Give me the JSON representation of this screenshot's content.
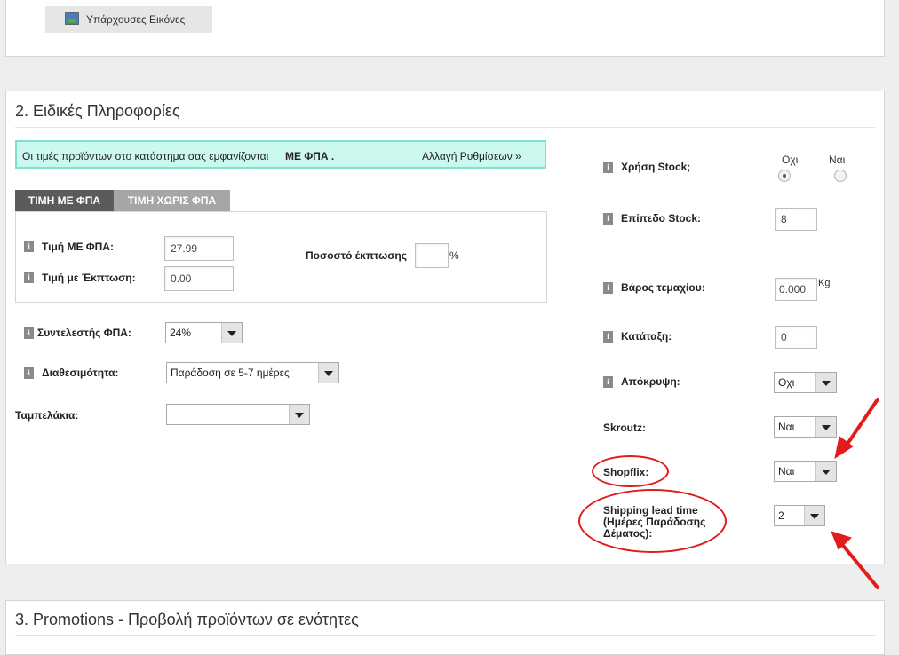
{
  "top_panel": {
    "existing_images_button": "Υπάρχουσες Εικόνες"
  },
  "section2": {
    "title": "2. Ειδικές Πληροφορίες",
    "notice": {
      "text": "Οι τιμές προϊόντων στο κατάστημα σας εμφανίζονται",
      "emphasis": "ΜΕ ΦΠΑ .",
      "link": "Αλλαγή Ρυθμίσεων »"
    },
    "tabs": [
      "ΤΙΜΗ ΜΕ ΦΠΑ",
      "ΤΙΜΗ ΧΩΡΙΣ ΦΠΑ"
    ],
    "price_with_vat": {
      "label": "Τιμή ΜΕ ΦΠΑ:",
      "value": "27.99"
    },
    "price_discount": {
      "label": "Τιμή με Έκπτωση:",
      "value": "0.00"
    },
    "discount_pct": {
      "label": "Ποσοστό έκπτωσης",
      "value": "",
      "unit": "%"
    },
    "vat_rate": {
      "label": "Συντελεστής ΦΠΑ:",
      "value": "24%"
    },
    "availability": {
      "label": "Διαθεσιμότητα:",
      "value": "Παράδοση σε 5-7 ημέρες"
    },
    "tags": {
      "label": "Ταμπελάκια:",
      "value": ""
    },
    "stock_use": {
      "label": "Χρήση Stock;",
      "no": "Οχι",
      "yes": "Ναι",
      "selected": "Οχι"
    },
    "stock_level": {
      "label": "Επίπεδο Stock:",
      "value": "8"
    },
    "weight": {
      "label": "Βάρος τεμαχίου:",
      "value": "0.000",
      "unit": "Kg"
    },
    "ranking": {
      "label": "Κατάταξη:",
      "value": "0"
    },
    "hidden": {
      "label": "Απόκρυψη:",
      "value": "Οχι"
    },
    "skroutz": {
      "label": "Skroutz:",
      "value": "Ναι"
    },
    "shopflix": {
      "label": "Shopflix:",
      "value": "Ναι"
    },
    "shipping_lead": {
      "label_line1": "Shipping lead time",
      "label_line2": "(Ημέρες Παράδοσης",
      "label_line3": "Δέματος):",
      "value": "2"
    },
    "info_icon_glyph": "i"
  },
  "section3": {
    "title": "3. Promotions - Προβολή προϊόντων σε ενότητες"
  },
  "colors": {
    "annotation": "#e21b1b",
    "notice_bg": "#ccf9ef",
    "active_tab": "#5b5b5b"
  }
}
